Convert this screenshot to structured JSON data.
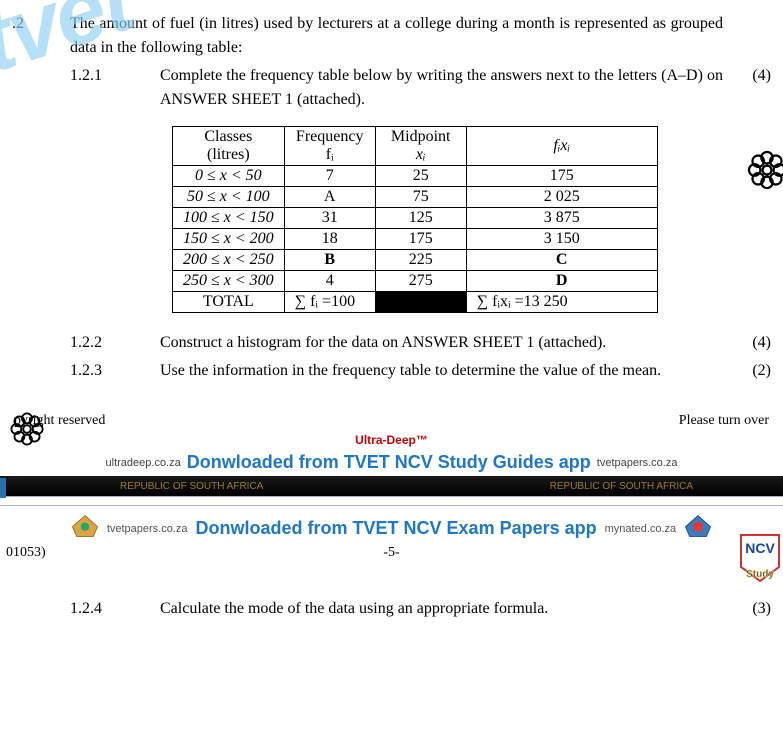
{
  "q_outer": ".2",
  "intro": "The amount of fuel (in litres) used by lecturers at a college during a month is represented as grouped data in the following table:",
  "q121_num": "1.2.1",
  "q121_text": "Complete the frequency table below by writing the answers next to the letters (A–D) on ANSWER SHEET 1 (attached).",
  "q121_marks": "(4)",
  "table": {
    "headers": {
      "classes_a": "Classes",
      "classes_b": "(litres)",
      "freq_a": "Frequency",
      "freq_b": "fᵢ",
      "mid_a": "Midpoint",
      "mid_b": "xᵢ",
      "fixi": "fᵢxᵢ"
    },
    "rows": [
      {
        "cls": "0 ≤ x < 50",
        "f": "7",
        "x": "25",
        "fx": "175"
      },
      {
        "cls": "50 ≤ x < 100",
        "f": "A",
        "x": "75",
        "fx": "2 025"
      },
      {
        "cls": "100 ≤ x < 150",
        "f": "31",
        "x": "125",
        "fx": "3 875"
      },
      {
        "cls": "150 ≤ x < 200",
        "f": "18",
        "x": "175",
        "fx": "3 150"
      },
      {
        "cls": "200 ≤ x < 250",
        "f": "B",
        "x": "225",
        "fx": "C"
      },
      {
        "cls": "250 ≤ x < 300",
        "f": "4",
        "x": "275",
        "fx": "D"
      }
    ],
    "total_label": "TOTAL",
    "sum_f": "∑ fᵢ =100",
    "sum_fx": "∑ fᵢxᵢ =13 250"
  },
  "q122_num": "1.2.2",
  "q122_text": "Construct a histogram for the data on ANSWER SHEET 1 (attached).",
  "q122_marks": "(4)",
  "q123_num": "1.2.3",
  "q123_text": "Use the information in the frequency table to determine the value of the mean.",
  "q123_marks": "(2)",
  "footer_left": "pyright reserved",
  "footer_right": "Please turn over",
  "ultra": "Ultra-Deep™",
  "banner1_left": "ultradeep.co.za",
  "banner1_main": "Donwloaded from TVET NCV Study Guides app",
  "banner1_right": "tvetpapers.co.za",
  "strip_text": "REPUBLIC OF SOUTH AFRICA",
  "banner2_left": "tvetpapers.co.za",
  "banner2_main": "Donwloaded from TVET NCV Exam Papers app",
  "banner2_right": "mynated.co.za",
  "paper_code": "01053)",
  "page_num": "-5-",
  "badge": "NCV",
  "badge_sub": "Study",
  "q124_num": "1.2.4",
  "q124_text": "Calculate the mode of the data using an appropriate formula.",
  "q124_marks": "(3)",
  "watermark": "tvet"
}
